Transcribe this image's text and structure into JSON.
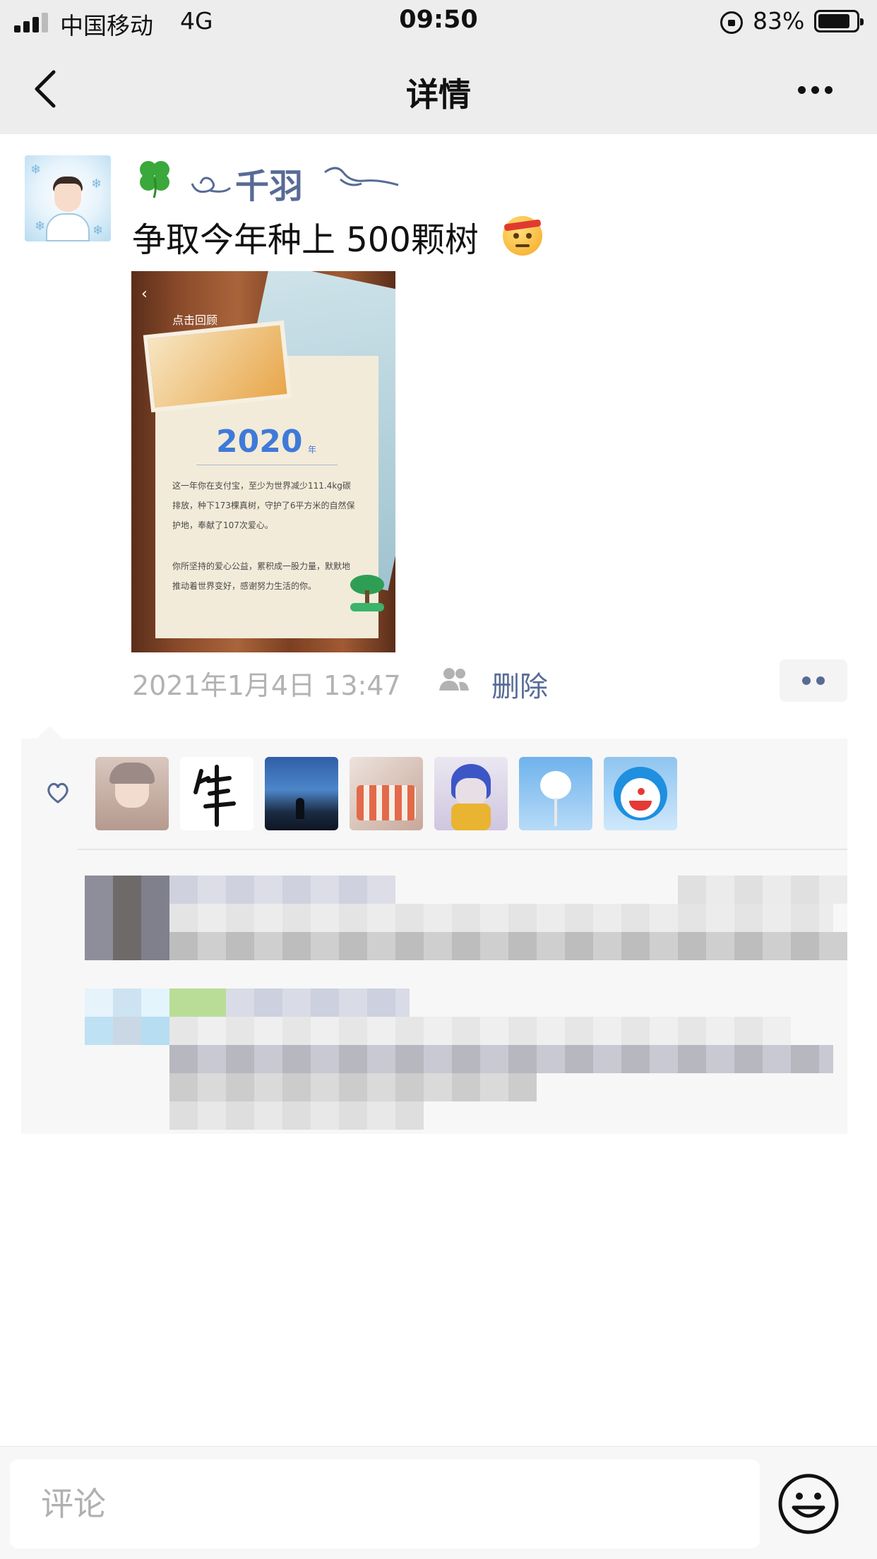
{
  "status_bar": {
    "carrier": "中国移动",
    "network": "4G",
    "time": "09:50",
    "battery": "83%"
  },
  "nav": {
    "title": "详情",
    "back_icon": "chevron-left-icon",
    "more_icon": "more-dots-icon"
  },
  "post": {
    "username": "千羽",
    "text": "争取今年种上 500颗树",
    "emoji": "angry-headband-emoji",
    "image": {
      "year": "2020",
      "year_suffix": "年",
      "recall_label": "点击回顾",
      "paragraph1": "这一年你在支付宝，至少为世界减少111.4kg碳排放，种下173棵真树，守护了6平方米的自然保护地，奉献了107次爱心。",
      "paragraph2": "你所坚持的爱心公益，累积成一股力量，默默地推动着世界变好，感谢努力生活的你。"
    },
    "timestamp": "2021年1月4日 13:47",
    "delete_label": "删除"
  },
  "comment_bar": {
    "placeholder": "评论",
    "emoji_icon": "smile-icon"
  },
  "colors": {
    "link_blue": "#576b95",
    "nav_bg": "#ededed",
    "panel_bg": "#f7f7f7",
    "meta_gray": "#b2b2b2"
  }
}
